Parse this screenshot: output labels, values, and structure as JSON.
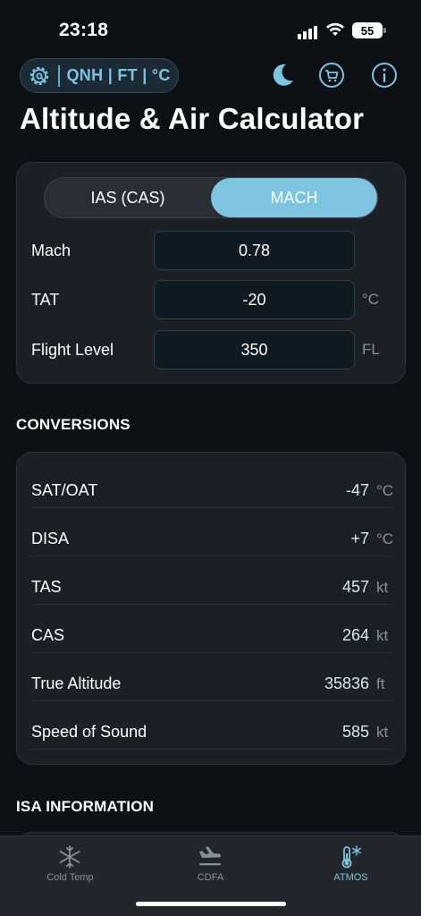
{
  "status_bar": {
    "time": "23:18",
    "battery": "55"
  },
  "header": {
    "units_label": "QNH | FT | °C",
    "title": "Altitude & Air Calculator",
    "icons": [
      "gear-icon",
      "moon-icon",
      "cart-icon",
      "info-icon"
    ]
  },
  "mode": {
    "options": [
      "IAS (CAS)",
      "MACH"
    ],
    "selected": "MACH"
  },
  "inputs": [
    {
      "label": "Mach",
      "value": "0.78",
      "unit": ""
    },
    {
      "label": "TAT",
      "value": "-20",
      "unit": "°C"
    },
    {
      "label": "Flight Level",
      "value": "350",
      "unit": "FL"
    }
  ],
  "conversions": {
    "title": "CONVERSIONS",
    "rows": [
      {
        "label": "SAT/OAT",
        "value": "-47",
        "unit": "°C"
      },
      {
        "label": "DISA",
        "value": "+7",
        "unit": "°C"
      },
      {
        "label": "TAS",
        "value": "457",
        "unit": "kt"
      },
      {
        "label": "CAS",
        "value": "264",
        "unit": "kt"
      },
      {
        "label": "True Altitude",
        "value": "35836",
        "unit": "ft"
      },
      {
        "label": "Speed of Sound",
        "value": "585",
        "unit": "kt"
      }
    ]
  },
  "isa": {
    "title": "ISA INFORMATION"
  },
  "tabs": [
    {
      "label": "Cold Temp",
      "icon": "snowflake-icon",
      "active": false
    },
    {
      "label": "CDFA",
      "icon": "plane-landing-icon",
      "active": false
    },
    {
      "label": "ATMOS",
      "icon": "thermometer-snow-icon",
      "active": true
    }
  ],
  "colors": {
    "accent": "#7cc4df",
    "background": "#0e1114",
    "card": "#1c2024"
  }
}
